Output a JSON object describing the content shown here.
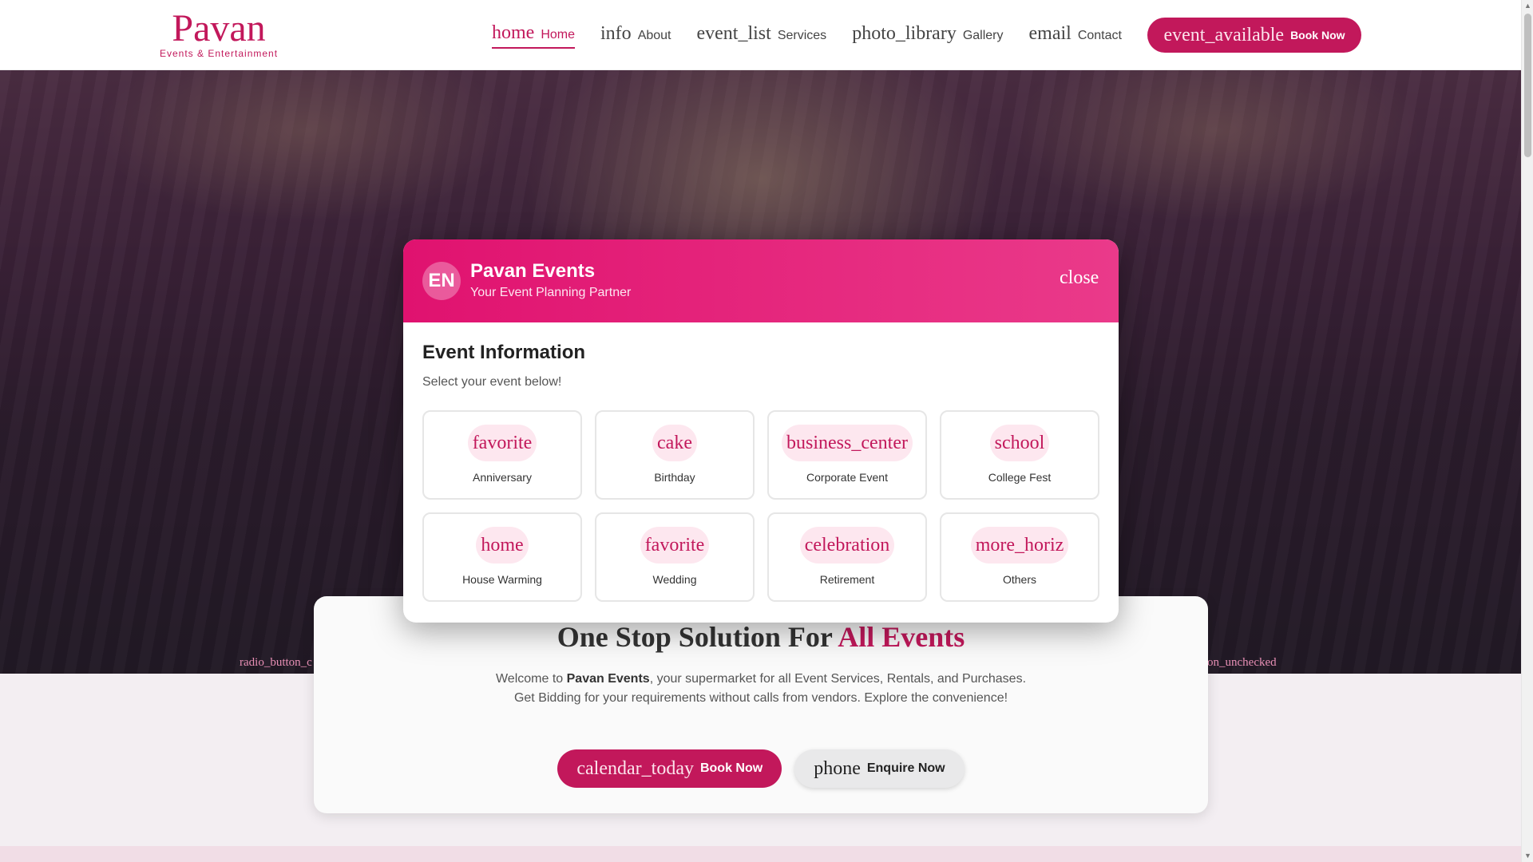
{
  "brand": {
    "name": "Pavan",
    "tagline": "Events & Entertainment"
  },
  "nav": [
    {
      "icon": "home",
      "label": "Home",
      "active": true
    },
    {
      "icon": "info",
      "label": "About"
    },
    {
      "icon": "event_list",
      "label": "Services"
    },
    {
      "icon": "photo_library",
      "label": "Gallery"
    },
    {
      "icon": "email",
      "label": "Contact"
    }
  ],
  "header_cta": {
    "icon": "event_available",
    "label": "Book Now"
  },
  "hero": {
    "radio_left": "radio_button_c",
    "radio_right": "on_unchecked",
    "headline_main": "One Stop Solution For",
    "headline_accent": "All Events",
    "intro_prefix": "Welcome to",
    "intro_brand": "Pavan Events",
    "intro_rest": ", your supermarket for all Event Services, Rentals, and Purchases.",
    "intro_line2": "Get Bidding for your requirements without calls from vendors. Explore the convenience!",
    "cta_primary": {
      "icon": "calendar_today",
      "label": "Book Now"
    },
    "cta_secondary": {
      "icon": "phone",
      "label": "Enquire Now"
    }
  },
  "modal": {
    "badge": "EN",
    "title": "Pavan Events",
    "subtitle": "Your Event Planning Partner",
    "close_label": "close",
    "section_title": "Event Information",
    "section_subtitle": "Select your event below!",
    "events": [
      {
        "icon": "favorite",
        "label": "Anniversary"
      },
      {
        "icon": "cake",
        "label": "Birthday"
      },
      {
        "icon": "business_center",
        "label": "Corporate Event"
      },
      {
        "icon": "school",
        "label": "College Fest"
      },
      {
        "icon": "home",
        "label": "House Warming"
      },
      {
        "icon": "favorite",
        "label": "Wedding"
      },
      {
        "icon": "celebration",
        "label": "Retirement"
      },
      {
        "icon": "more_horiz",
        "label": "Others"
      }
    ]
  },
  "colors": {
    "brand": "#c2185b",
    "modal_header": "#e0126f",
    "icon_bg": "#fde7ef"
  }
}
